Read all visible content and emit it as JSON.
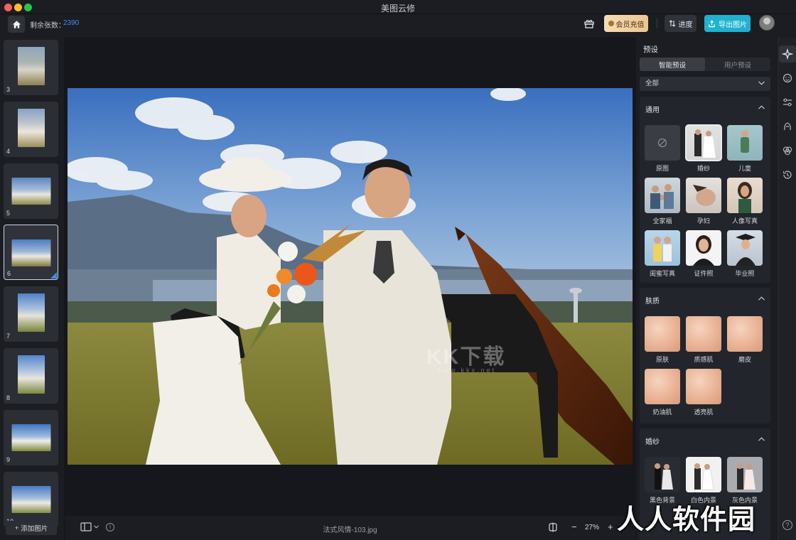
{
  "window": {
    "title": "美图云修"
  },
  "toolbar": {
    "remaining_label": "剩余张数：",
    "remaining_count": "2390",
    "vip_label": "会员充值",
    "progress_label": "进度",
    "export_label": "导出图片"
  },
  "filmstrip": {
    "items": [
      {
        "number": "3",
        "orientation": "portrait",
        "selected": false
      },
      {
        "number": "4",
        "orientation": "portrait",
        "selected": false
      },
      {
        "number": "5",
        "orientation": "landscape",
        "selected": false
      },
      {
        "number": "6",
        "orientation": "landscape",
        "selected": true
      },
      {
        "number": "7",
        "orientation": "portrait",
        "selected": false
      },
      {
        "number": "8",
        "orientation": "portrait",
        "selected": false
      },
      {
        "number": "9",
        "orientation": "landscape",
        "selected": false
      },
      {
        "number": "10",
        "orientation": "landscape",
        "selected": false
      }
    ],
    "add_label": "添加图片"
  },
  "canvas": {
    "filename": "法式风情-103.jpg",
    "zoom": "27%"
  },
  "presets": {
    "title": "预设",
    "tabs": [
      {
        "label": "智能预设",
        "active": true
      },
      {
        "label": "用户预设",
        "active": false
      }
    ],
    "filter_value": "全部",
    "sections": {
      "general": {
        "title": "通用",
        "items": [
          {
            "label": "原图"
          },
          {
            "label": "婚纱"
          },
          {
            "label": "儿童"
          },
          {
            "label": "全家福"
          },
          {
            "label": "孕妇"
          },
          {
            "label": "人像写真"
          },
          {
            "label": "闺蜜写真"
          },
          {
            "label": "证件照"
          },
          {
            "label": "毕业照"
          }
        ]
      },
      "skin": {
        "title": "肤质",
        "items": [
          {
            "label": "原肤"
          },
          {
            "label": "质感肌"
          },
          {
            "label": "磨皮"
          },
          {
            "label": "奶油肌"
          },
          {
            "label": "透亮肌"
          }
        ]
      },
      "wedding": {
        "title": "婚纱",
        "items": [
          {
            "label": "黑色背景"
          },
          {
            "label": "白色内景"
          },
          {
            "label": "灰色内景"
          }
        ]
      }
    }
  },
  "watermark": {
    "site": "人人软件园",
    "overlay": "KK下载",
    "url": "www.kkx.net"
  },
  "colors": {
    "accent": "#3b8df7",
    "export": "#1fb1d0",
    "vip": "#ecc690"
  }
}
